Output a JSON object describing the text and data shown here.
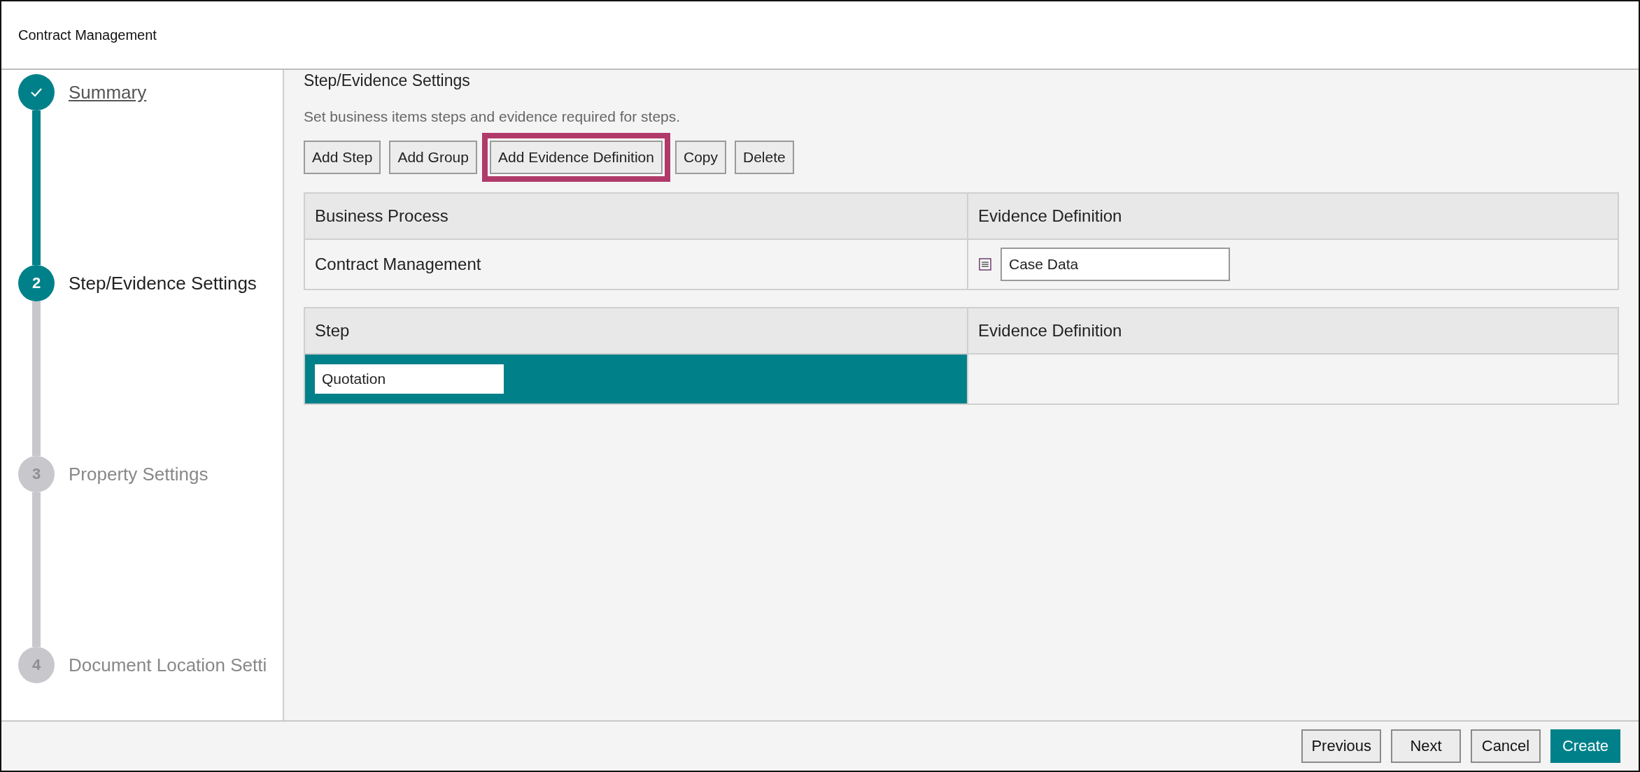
{
  "window": {
    "title": "Contract Management"
  },
  "steps": [
    {
      "label": "Summary",
      "completed": true,
      "current": false
    },
    {
      "number": "2",
      "label": "Step/Evidence Settings",
      "completed": false,
      "current": true
    },
    {
      "number": "3",
      "label": "Property Settings",
      "completed": false,
      "current": false
    },
    {
      "number": "4",
      "label": "Document Location Setti",
      "completed": false,
      "current": false
    }
  ],
  "section": {
    "title": "Step/Evidence Settings",
    "description": "Set business items steps and evidence required for steps."
  },
  "toolbar": [
    {
      "label": "Add Step",
      "highlighted": false
    },
    {
      "label": "Add Group",
      "highlighted": false
    },
    {
      "label": "Add Evidence Definition",
      "highlighted": true
    },
    {
      "label": "Copy",
      "highlighted": false
    },
    {
      "label": "Delete",
      "highlighted": false
    }
  ],
  "process_table": {
    "columns": [
      "Business Process",
      "Evidence Definition"
    ],
    "rows": [
      {
        "name": "Contract Management",
        "evidence": "Case Data",
        "selected": false
      }
    ]
  },
  "step_table": {
    "columns": [
      "Step",
      "Evidence Definition"
    ],
    "rows": [
      {
        "name": "Quotation",
        "selected": true
      }
    ]
  },
  "footer": [
    {
      "label": "Previous",
      "primary": false
    },
    {
      "label": "Next",
      "primary": false
    },
    {
      "label": "Cancel",
      "primary": false
    },
    {
      "label": "Create",
      "primary": true
    }
  ]
}
